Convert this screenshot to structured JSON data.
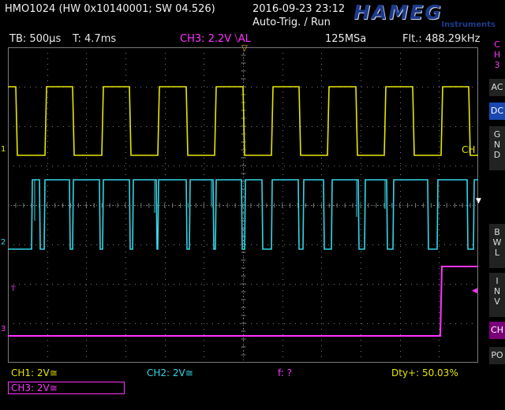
{
  "header": {
    "device": "HMO1024 (HW 0x10140001; SW 04.526)",
    "datetime": "2016-09-23 23:12",
    "trigger_state": "Auto-Trig. / Run",
    "brand": "HAMEG",
    "brand_sub": "Instruments"
  },
  "status_bar": {
    "timebase": "TB: 500µs",
    "trigger_time": "T: 4.7ms",
    "trigger_channel": "CH3: 2.2V ⧹AL",
    "sample_rate": "125MSa",
    "filter": "Flt.: 488.29kHz"
  },
  "right_menu": {
    "ch_label": "C\nH\n3",
    "buttons": [
      {
        "label": "AC",
        "active": false
      },
      {
        "label": "DC",
        "active": true
      },
      {
        "label": "G\nN\nD",
        "active": false
      },
      {
        "label": "B\nW\nL",
        "active": false
      },
      {
        "label": "I\nN\nV",
        "active": false
      },
      {
        "label": "CH",
        "active": false
      },
      {
        "label": "PO",
        "active": false
      }
    ]
  },
  "screen_labels": {
    "ch1_marker": "1",
    "ch2_marker": "2",
    "ch3_marker": "3",
    "trigger_marker": "T",
    "ch_overlay": "CH"
  },
  "bottom_bar": {
    "ch1": "CH1: 2V≅",
    "ch2": "CH2: 2V≅",
    "freq": "f: ?",
    "duty": "Dty+: 50.03%",
    "ch3": "CH3: 2V≅"
  },
  "colors": {
    "ch1": "#e6e600",
    "ch2": "#33d6e6",
    "ch3": "#ff33ff",
    "grid": "#7a7a7a",
    "brand": "#1d3a8a"
  }
}
